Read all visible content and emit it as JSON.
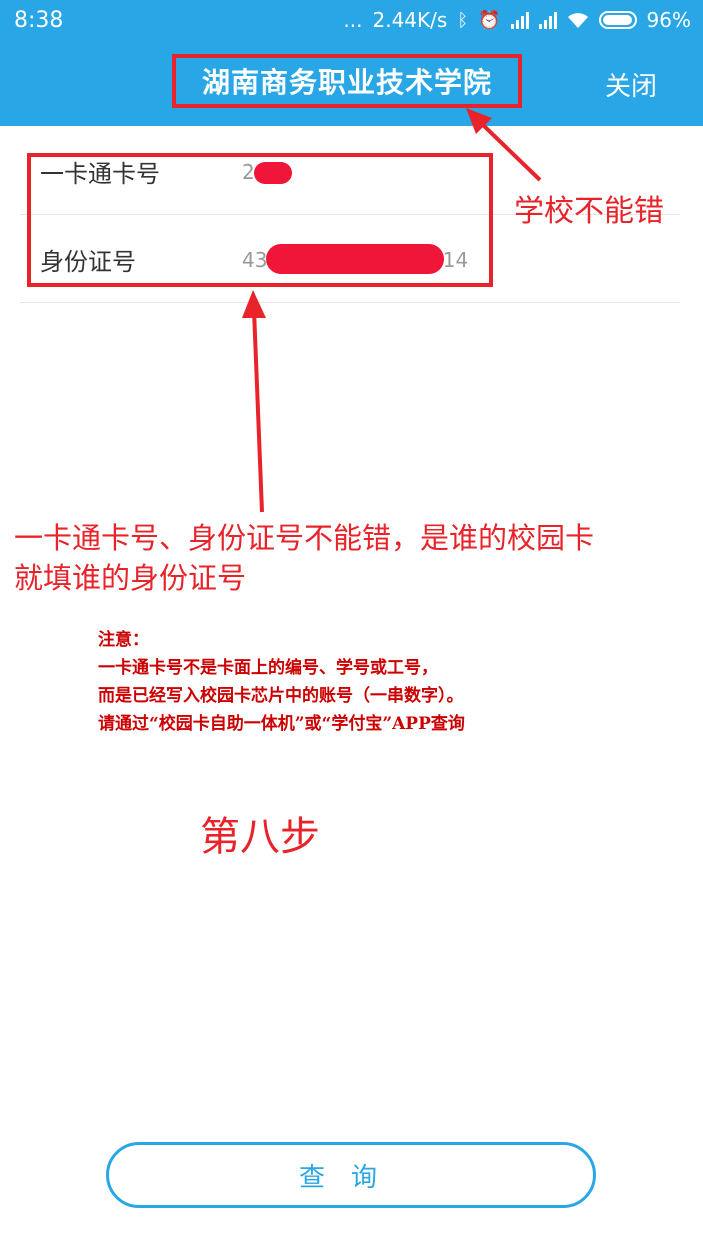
{
  "status_bar": {
    "time": "8:38",
    "dots": "...",
    "network_speed": "2.44K/s",
    "battery": "96%",
    "icons": [
      "bluetooth-icon",
      "alarm-icon",
      "signal-icon",
      "signal-icon",
      "wifi-icon",
      "battery-icon"
    ]
  },
  "app_bar": {
    "title": "湖南商务职业技术学院",
    "close_label": "关闭"
  },
  "form": {
    "card_label": "一卡通卡号",
    "card_value_visible": "2",
    "id_label": "身份证号",
    "id_value_start": "43",
    "id_value_end": "514"
  },
  "annotations": {
    "school": "学校不能错",
    "main_line1": "一卡通卡号、身份证号不能错，是谁的校园卡",
    "main_line2": "就填谁的身份证号",
    "note_title": "注意：",
    "note_line1": "一卡通卡号不是卡面上的编号、学号或工号，",
    "note_line2": "而是已经写入校园卡芯片中的账号（一串数字）。",
    "note_line3": "请通过“校园卡自助一体机”或“学付宝”APP查询",
    "step": "第八步"
  },
  "query_button": {
    "label": "查询"
  },
  "colors": {
    "primary": "#29a6e6",
    "annotation_red": "#e8232a",
    "redact": "#f0163a"
  }
}
